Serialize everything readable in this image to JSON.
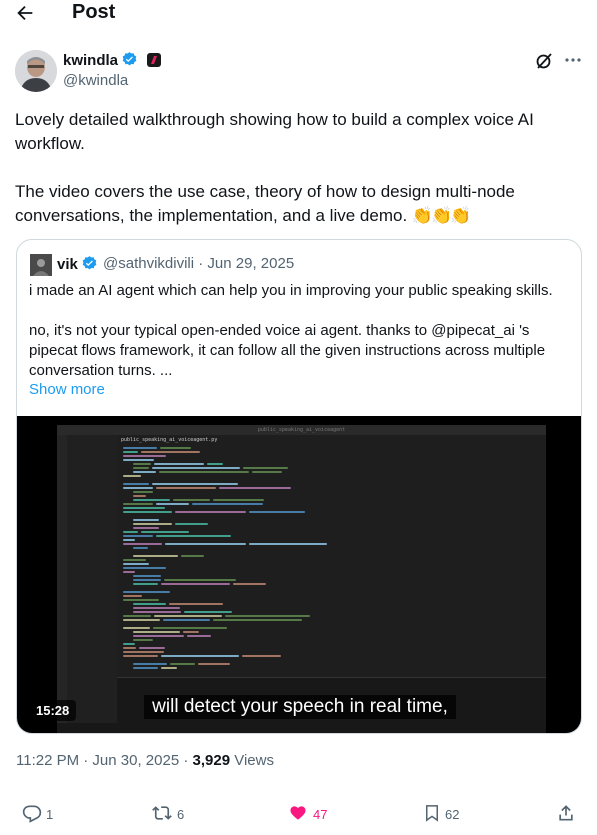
{
  "header": {
    "title": "Post"
  },
  "author": {
    "name": "kwindla",
    "handle": "@kwindla"
  },
  "tweet": {
    "paragraph1": "Lovely detailed walkthrough showing how to build a complex voice AI workflow.",
    "paragraph2": "The video covers the use case, theory of how to design multi-node conversations, the implementation, and a live demo.",
    "emoji": "👏👏👏"
  },
  "quote": {
    "name": "vik",
    "handle_date": "@sathvikdivili · Jun 29, 2025",
    "paragraph1": "i made an AI agent which can help you in improving your public speaking skills.",
    "paragraph2": "no, it's not your typical open-ended voice ai agent. thanks to @pipecat_ai 's pipecat flows framework, it can  follow all the given instructions across multiple conversation turns. ...",
    "show_more": "Show more",
    "video": {
      "caption": "will detect your speech in real time,",
      "duration": "15:28",
      "editor_title": "public_speaking_ai_voiceagent",
      "editor_tab": "public_speaking_ai_voiceagent.py"
    }
  },
  "meta": {
    "time": "11:22 PM · Jun 30, 2025 · ",
    "views_count": "3,929",
    "views_label": " Views"
  },
  "actions": {
    "replies": "1",
    "reposts": "6",
    "likes": "47",
    "bookmarks": "62"
  },
  "colors": {
    "accent": "#1d9bf0",
    "like": "#f91880",
    "muted": "#536471"
  },
  "icons": [
    "back-arrow-icon",
    "verified-badge-icon",
    "affiliate-badge-icon",
    "grok-icon",
    "more-icon",
    "reply-icon",
    "repost-icon",
    "like-icon",
    "bookmark-icon",
    "share-icon"
  ]
}
